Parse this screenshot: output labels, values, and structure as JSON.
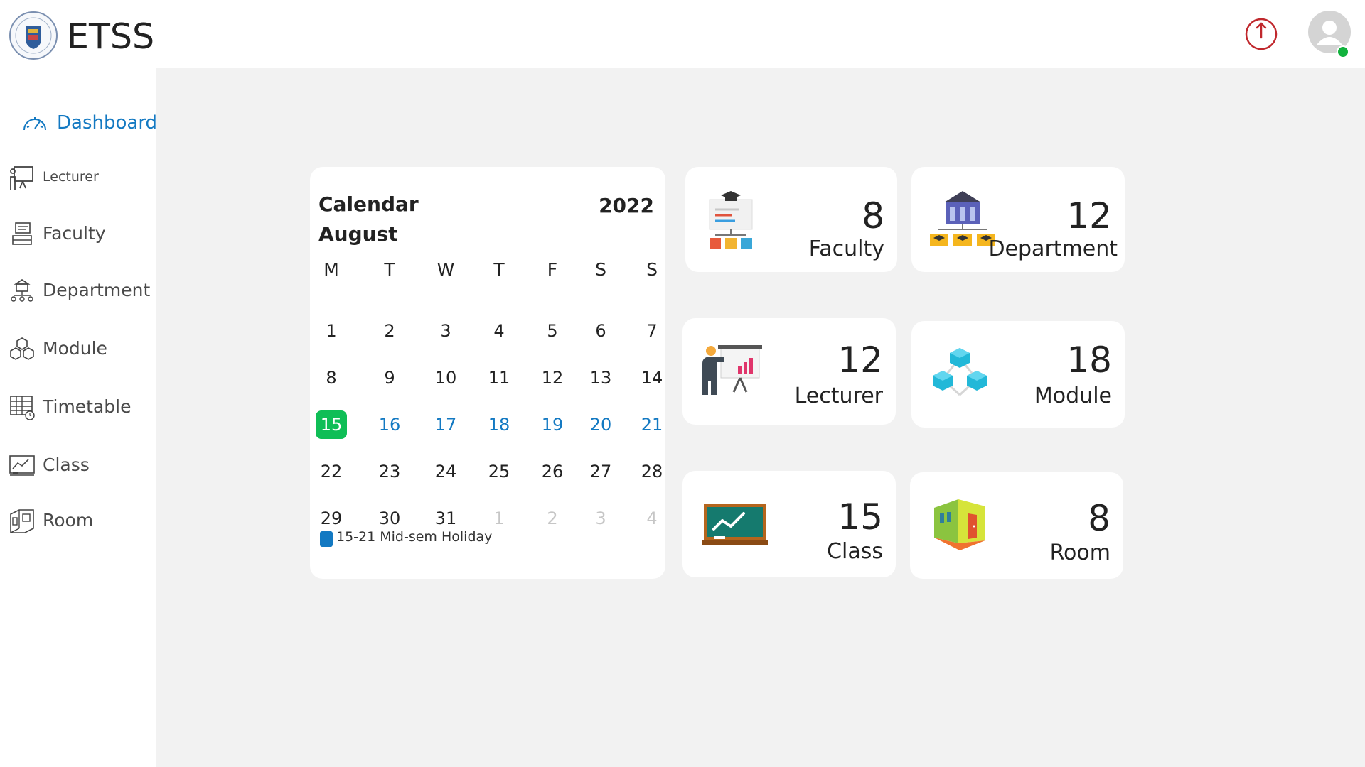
{
  "app": {
    "title": "ETSS"
  },
  "sidebar": {
    "items": [
      {
        "label": "Dashboard",
        "icon": "dashboard-gauge-icon",
        "active": true
      },
      {
        "label": "Lecturer",
        "icon": "lecturer-icon"
      },
      {
        "label": "Faculty",
        "icon": "faculty-icon"
      },
      {
        "label": "Department",
        "icon": "department-icon"
      },
      {
        "label": "Module",
        "icon": "module-icon"
      },
      {
        "label": "Timetable",
        "icon": "timetable-icon"
      },
      {
        "label": "Class",
        "icon": "class-icon"
      },
      {
        "label": "Room",
        "icon": "room-icon"
      }
    ]
  },
  "calendar": {
    "title": "Calendar",
    "month": "August",
    "year": "2022",
    "weekdays": [
      "M",
      "T",
      "W",
      "T",
      "F",
      "S",
      "S"
    ],
    "weeks": [
      [
        "1",
        "2",
        "3",
        "4",
        "5",
        "6",
        "7"
      ],
      [
        "8",
        "9",
        "10",
        "11",
        "12",
        "13",
        "14"
      ],
      [
        "15",
        "16",
        "17",
        "18",
        "19",
        "20",
        "21"
      ],
      [
        "22",
        "23",
        "24",
        "25",
        "26",
        "27",
        "28"
      ],
      [
        "29",
        "30",
        "31",
        "1",
        "2",
        "3",
        "4"
      ]
    ],
    "today": "15",
    "holiday_days": [
      "16",
      "17",
      "18",
      "19",
      "20",
      "21"
    ],
    "next_month_days_count": 4,
    "legend": {
      "text": "15-21 Mid-sem Holiday",
      "color": "#1379c2"
    }
  },
  "stats": {
    "faculty": {
      "value": "8",
      "label": "Faculty",
      "icon": "faculty-hierarchy-icon"
    },
    "department": {
      "value": "12",
      "label": "Department",
      "icon": "department-building-icon"
    },
    "lecturer": {
      "value": "12",
      "label": "Lecturer",
      "icon": "lecturer-presentation-icon"
    },
    "module": {
      "value": "18",
      "label": "Module",
      "icon": "module-cubes-icon"
    },
    "class": {
      "value": "15",
      "label": "Class",
      "icon": "classroom-board-icon"
    },
    "room": {
      "value": "8",
      "label": "Room",
      "icon": "room-door-icon"
    }
  },
  "colors": {
    "accent": "#1379c2",
    "today": "#0fbe56",
    "power": "#c0282d",
    "online": "#11b23d",
    "main_bg": "#f2f2f2"
  }
}
